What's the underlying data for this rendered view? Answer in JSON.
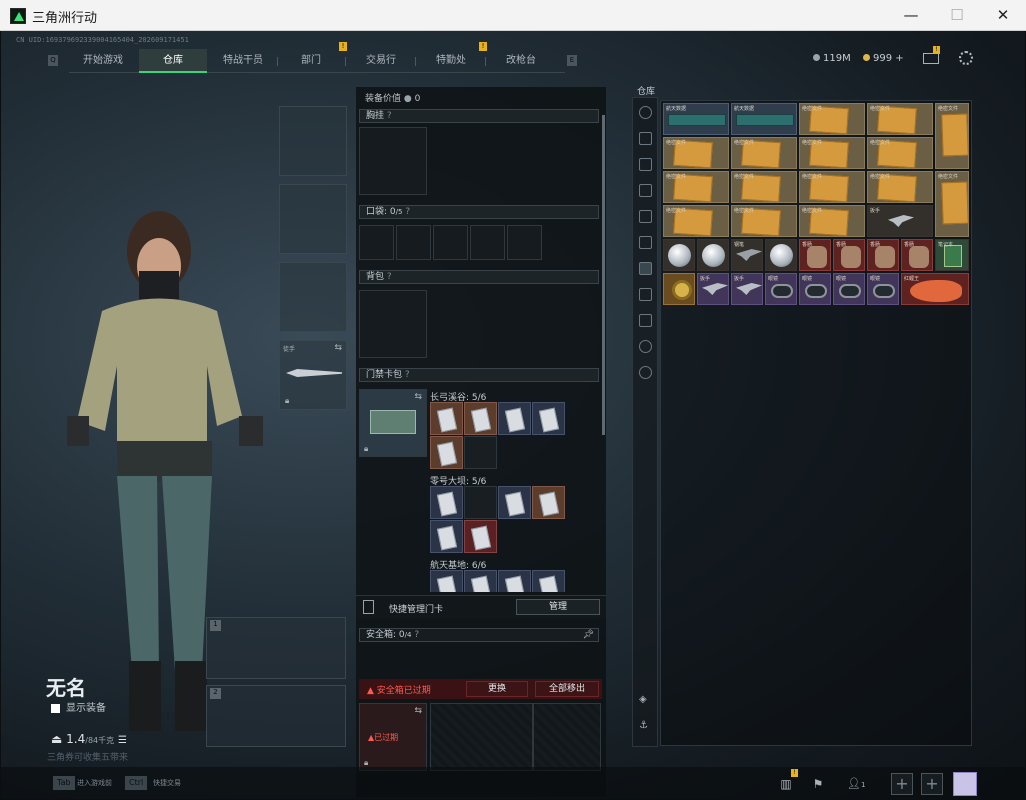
{
  "window": {
    "title": "三角洲行动",
    "minimize": "—",
    "maximize": "☐",
    "close": "✕"
  },
  "uid": "CN UID:169379692339004165404_202609171451",
  "nav": {
    "left_key": "Q",
    "right_key": "E",
    "tabs": [
      {
        "label": "开始游戏",
        "active": false,
        "badge": ""
      },
      {
        "label": "仓库",
        "active": true,
        "badge": ""
      },
      {
        "label": "特战干员",
        "active": false,
        "badge": ""
      },
      {
        "label": "部门",
        "active": false,
        "badge": "!"
      },
      {
        "label": "交易行",
        "active": false,
        "badge": ""
      },
      {
        "label": "特勤处",
        "active": false,
        "badge": "!"
      },
      {
        "label": "改枪台",
        "active": false,
        "badge": ""
      }
    ]
  },
  "currency": {
    "coins": "119M",
    "gems": "999",
    "plus": "+",
    "mail_badge": "!"
  },
  "character": {
    "name": "无名",
    "show_gear_label": "显示装备",
    "weight": "1.4",
    "weight_max": "/84千克",
    "hint": "三角券可收集五带来"
  },
  "equipment": {
    "melee_label": "徒手",
    "slot1_number": "1",
    "slot2_number": "2"
  },
  "midpanel": {
    "value_label": "装备价值",
    "value": "0",
    "chest_rig": "胸挂",
    "pockets": "口袋:",
    "pockets_count": "0",
    "pockets_unit": "/5",
    "backpack": "背包",
    "keycard_bag": "门禁卡包",
    "keycard_groups": [
      {
        "title": "长弓溪谷: 5/6"
      },
      {
        "title": "零号大坝: 5/6"
      },
      {
        "title": "航天基地: 6/6"
      }
    ],
    "quick_manage": "快捷管理门卡",
    "manage_btn": "管理",
    "safe_box": "安全箱:",
    "safe_count": "0",
    "safe_unit": "/4",
    "safe_expired_alert": "安全箱已过期",
    "replace_btn": "更换",
    "move_all_btn": "全部移出",
    "expired_tag": "已过期"
  },
  "warehouse": {
    "title": "仓库",
    "labels": {
      "aerospace_data": "航天数据",
      "secret_doc": "绝密文件",
      "blueprint": "图纸",
      "pen": "钢笔",
      "sausage": "香肠",
      "wrench": "扳手",
      "goggles": "眼镜",
      "fish": "红鲤王",
      "book": "笔记本"
    }
  },
  "bottom": {
    "tab_key": "Tab",
    "tab_hint": "进入游戏前",
    "ctrl_key": "Ctrl",
    "ctrl_hint": "快捷交易",
    "badge": "!",
    "squad_count": "1"
  }
}
